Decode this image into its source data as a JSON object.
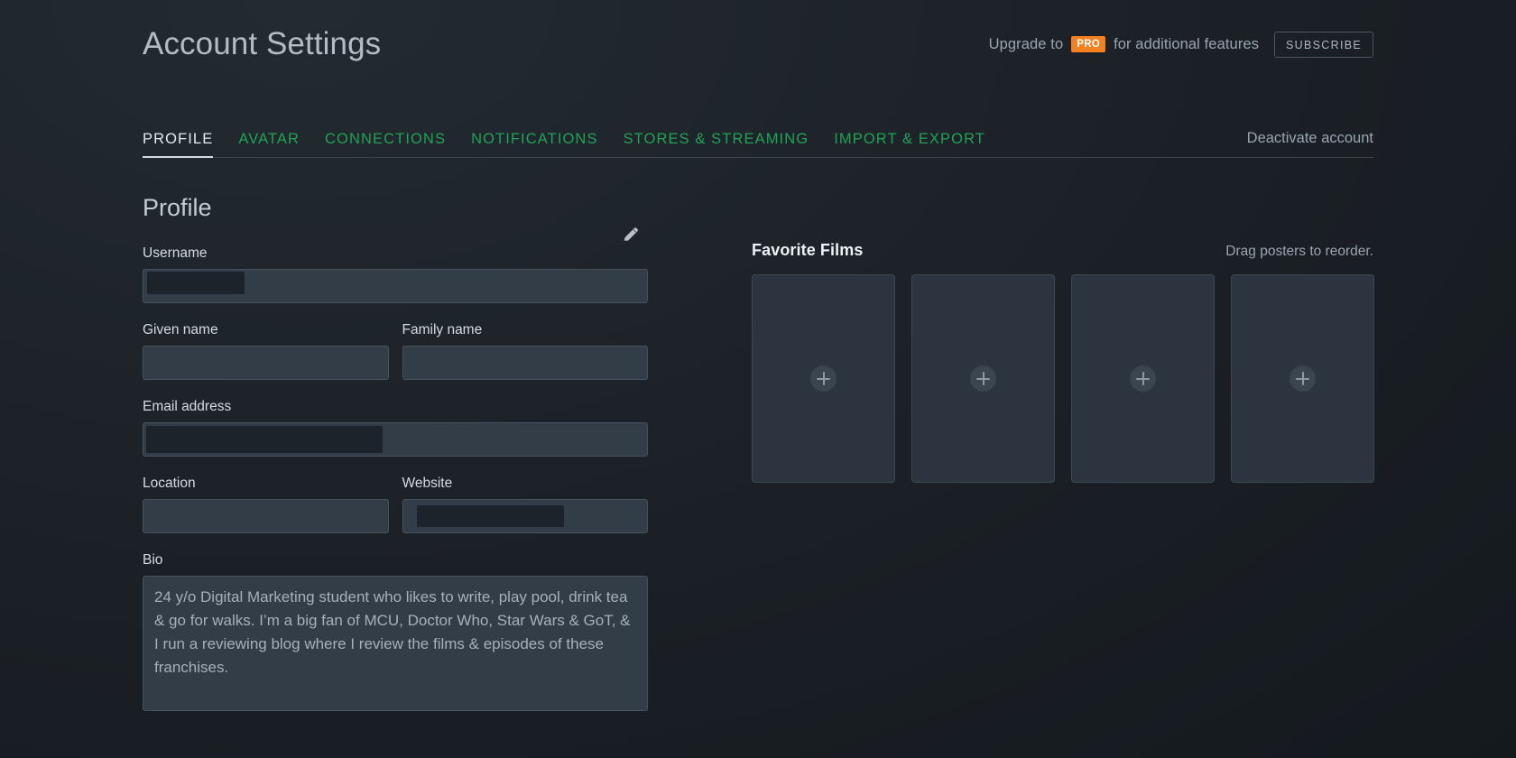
{
  "header": {
    "title": "Account Settings",
    "upgrade_prefix": "Upgrade to",
    "pro_badge": "PRO",
    "upgrade_suffix": "for additional features",
    "subscribe_label": "SUBSCRIBE",
    "pro_badge_color": "#f58020"
  },
  "tabs": {
    "items": [
      {
        "label": "PROFILE",
        "active": true
      },
      {
        "label": "AVATAR",
        "active": false
      },
      {
        "label": "CONNECTIONS",
        "active": false
      },
      {
        "label": "NOTIFICATIONS",
        "active": false
      },
      {
        "label": "STORES & STREAMING",
        "active": false
      },
      {
        "label": "IMPORT & EXPORT",
        "active": false
      }
    ],
    "deactivate_label": "Deactivate account",
    "link_color": "#1fa355",
    "active_color": "#e3e9ef"
  },
  "profile": {
    "section_title": "Profile",
    "fields": {
      "username": {
        "label": "Username",
        "value": "",
        "redacted": true
      },
      "given_name": {
        "label": "Given name",
        "value": ""
      },
      "family_name": {
        "label": "Family name",
        "value": ""
      },
      "email": {
        "label": "Email address",
        "value": "",
        "redacted": true
      },
      "location": {
        "label": "Location",
        "value": ""
      },
      "website": {
        "label": "Website",
        "value": "",
        "redacted": true
      },
      "bio": {
        "label": "Bio",
        "value": "24 y/o Digital Marketing student who likes to write, play pool, drink tea & go for walks. I’m a big fan of MCU, Doctor Who, Star Wars & GoT, & I run a reviewing blog where I review the films & episodes of these franchises."
      }
    },
    "edit_icon": "pencil-icon"
  },
  "favorite_films": {
    "title": "Favorite Films",
    "hint": "Drag posters to reorder.",
    "slots": [
      {
        "label": "",
        "icon": "plus-icon"
      },
      {
        "label": "",
        "icon": "plus-icon"
      },
      {
        "label": "",
        "icon": "plus-icon"
      },
      {
        "label": "",
        "icon": "plus-icon"
      }
    ]
  }
}
